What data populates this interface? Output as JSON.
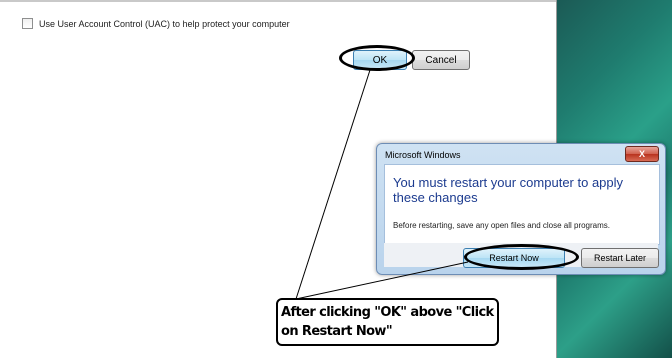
{
  "main_window": {
    "uac_checkbox_label": "Use User Account Control (UAC) to help protect your computer",
    "uac_checked": false,
    "ok_label": "OK",
    "cancel_label": "Cancel"
  },
  "restart_dialog": {
    "title": "Microsoft Windows",
    "close_glyph": "X",
    "message": "You must restart your computer to apply these changes",
    "subtext": "Before restarting, save any open files and close all programs.",
    "restart_now_label": "Restart Now",
    "restart_later_label": "Restart Later"
  },
  "annotation": {
    "callout_text": "After clicking \"OK\" above \"Click on Restart Now\""
  },
  "colors": {
    "dialog_message": "#1c3b8f",
    "desktop_teal": "#2aa089",
    "close_button_red": "#c8462f"
  }
}
